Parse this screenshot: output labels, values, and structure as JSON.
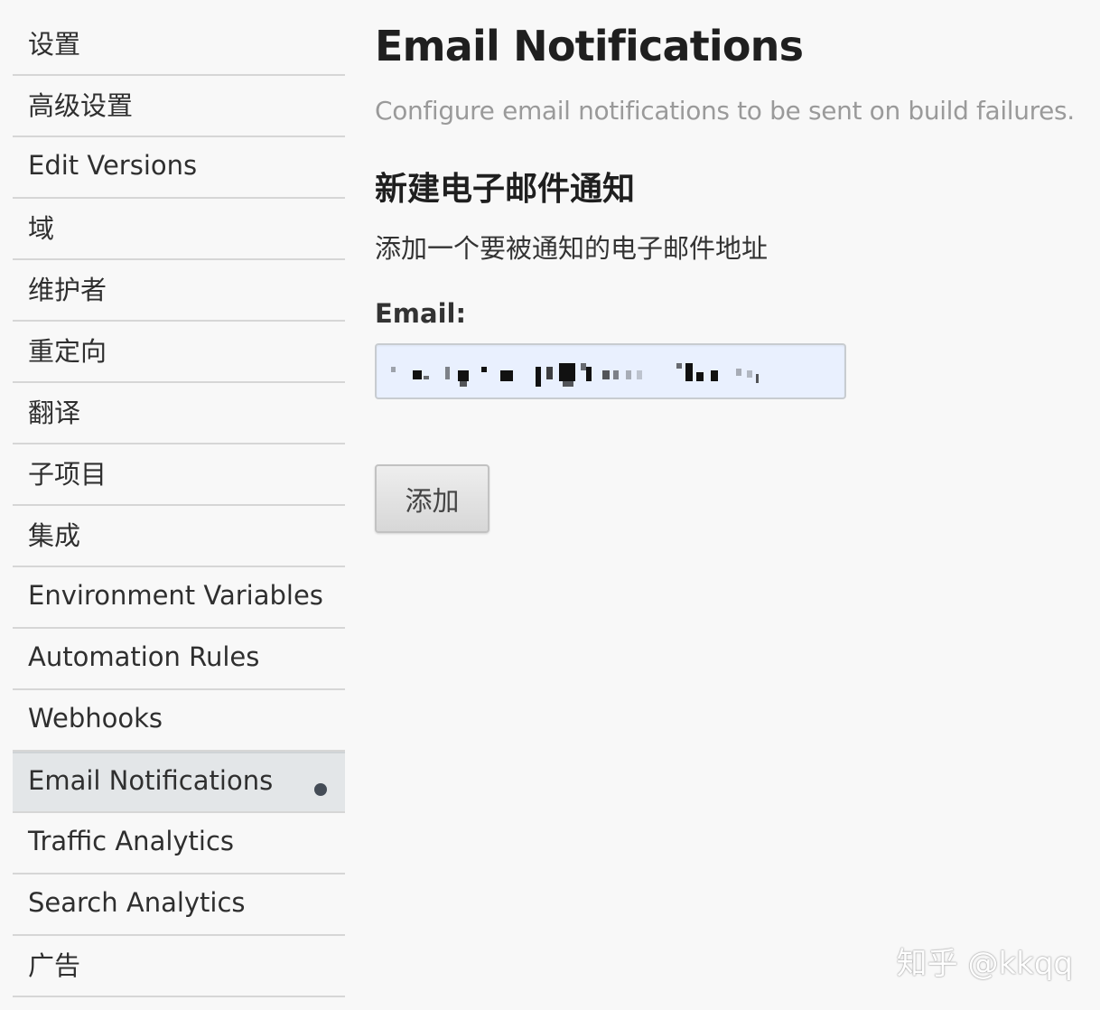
{
  "sidebar": {
    "items": [
      {
        "label": "设置"
      },
      {
        "label": "高级设置"
      },
      {
        "label": "Edit Versions"
      },
      {
        "label": "域"
      },
      {
        "label": "维护者"
      },
      {
        "label": "重定向"
      },
      {
        "label": "翻译"
      },
      {
        "label": "子项目"
      },
      {
        "label": "集成"
      },
      {
        "label": "Environment Variables"
      },
      {
        "label": "Automation Rules"
      },
      {
        "label": "Webhooks"
      },
      {
        "label": "Email Notifications",
        "active": true
      },
      {
        "label": "Traffic Analytics"
      },
      {
        "label": "Search Analytics"
      },
      {
        "label": "广告"
      }
    ]
  },
  "main": {
    "title": "Email Notifications",
    "subtitle": "Configure email notifications to be sent on build failures.",
    "section_title": "新建电子邮件通知",
    "section_description": "添加一个要被通知的电子邮件地址",
    "email_label": "Email:",
    "add_button_label": "添加"
  },
  "watermark": "知乎 @kkqq",
  "colors": {
    "background": "#f8f8f8",
    "active_item_bg": "#e3e6e8",
    "input_bg": "#e9f0fe",
    "subtitle_text": "#9a9a9a"
  }
}
